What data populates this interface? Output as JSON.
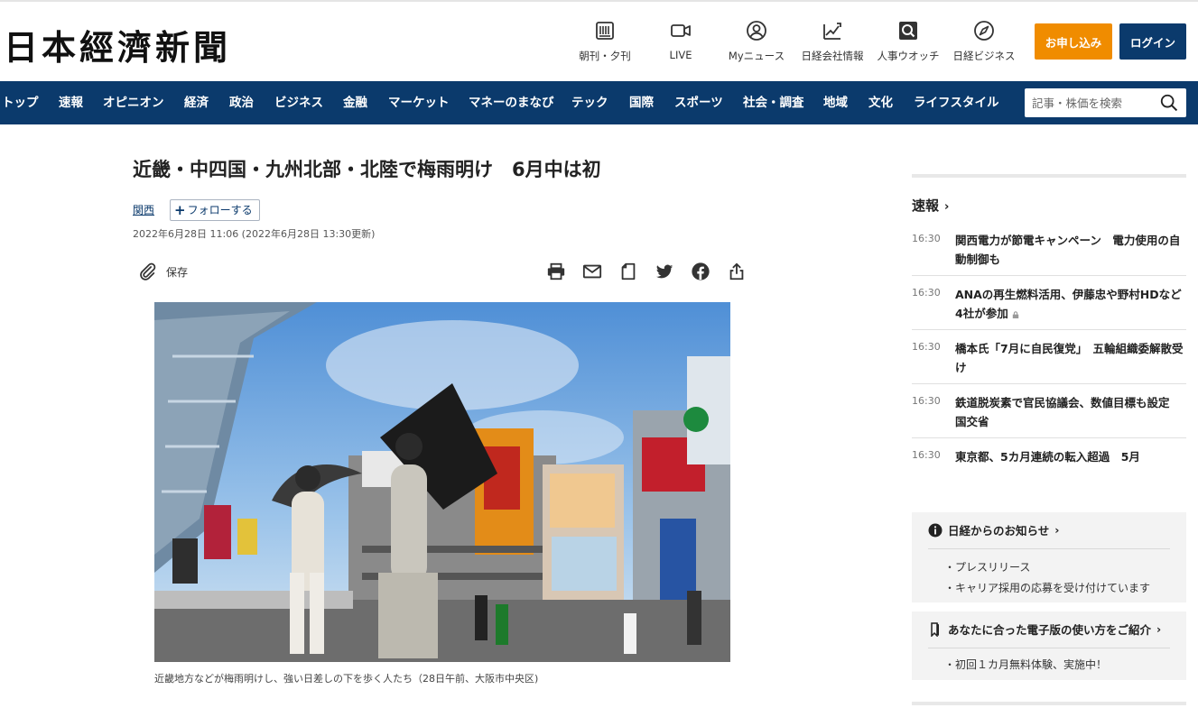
{
  "header": {
    "logo": "日本經濟新聞",
    "icons": [
      {
        "label": "朝刊・夕刊",
        "icon": "newspaper-icon"
      },
      {
        "label": "LIVE",
        "icon": "video-camera-icon"
      },
      {
        "label": "Myニュース",
        "icon": "user-icon"
      },
      {
        "label": "日経会社情報",
        "icon": "chart-pen-icon"
      },
      {
        "label": "人事ウオッチ",
        "icon": "magnifier-icon"
      },
      {
        "label": "日経ビジネス",
        "icon": "compass-icon"
      }
    ],
    "apply_label": "お申し込み",
    "login_label": "ログイン"
  },
  "nav": {
    "items": [
      "トップ",
      "速報",
      "オピニオン",
      "経済",
      "政治",
      "ビジネス",
      "金融",
      "マーケット",
      "マネーのまなび",
      "テック",
      "国際",
      "スポーツ",
      "社会・調査",
      "地域",
      "文化",
      "ライフスタイル"
    ],
    "search_placeholder": "記事・株価を検索"
  },
  "article": {
    "title": "近畿・中四国・九州北部・北陸で梅雨明け　6月中は初",
    "topic": "関西",
    "follow_label": "フォローする",
    "date": "2022年6月28日 11:06 (2022年6月28日 13:30更新)",
    "save_label": "保存",
    "share_icons": [
      "print-icon",
      "mail-icon",
      "clip-icon",
      "twitter-icon",
      "facebook-icon",
      "share-icon"
    ],
    "caption": "近畿地方などが梅雨明けし、強い日差しの下を歩く人たち（28日午前、大阪市中央区)"
  },
  "sidebar": {
    "heading": "速報",
    "news": [
      {
        "time": "16:30",
        "headline": "関西電力が節電キャンペーン　電力使用の自動制御も",
        "locked": false
      },
      {
        "time": "16:30",
        "headline": "ANAの再生燃料活用、伊藤忠や野村HDなど4社が参加",
        "locked": true
      },
      {
        "time": "16:30",
        "headline": "橋本氏「7月に自民復党」　五輪組織委解散受け",
        "locked": false
      },
      {
        "time": "16:30",
        "headline": "鉄道脱炭素で官民協議会、数値目標も設定　国交省",
        "locked": false
      },
      {
        "time": "16:30",
        "headline": "東京都、5カ月連続の転入超過　5月",
        "locked": false
      }
    ],
    "notice1": {
      "heading": "日経からのお知らせ",
      "items": [
        "・プレスリリース",
        "・キャリア採用の応募を受け付けています"
      ]
    },
    "notice2": {
      "heading": "あなたに合った電子版の使い方をご紹介",
      "items": [
        "・初回１カ月無料体験、実施中！"
      ]
    }
  },
  "colors": {
    "brand_navy": "#0b3a6c",
    "accent_orange": "#f08c00"
  }
}
